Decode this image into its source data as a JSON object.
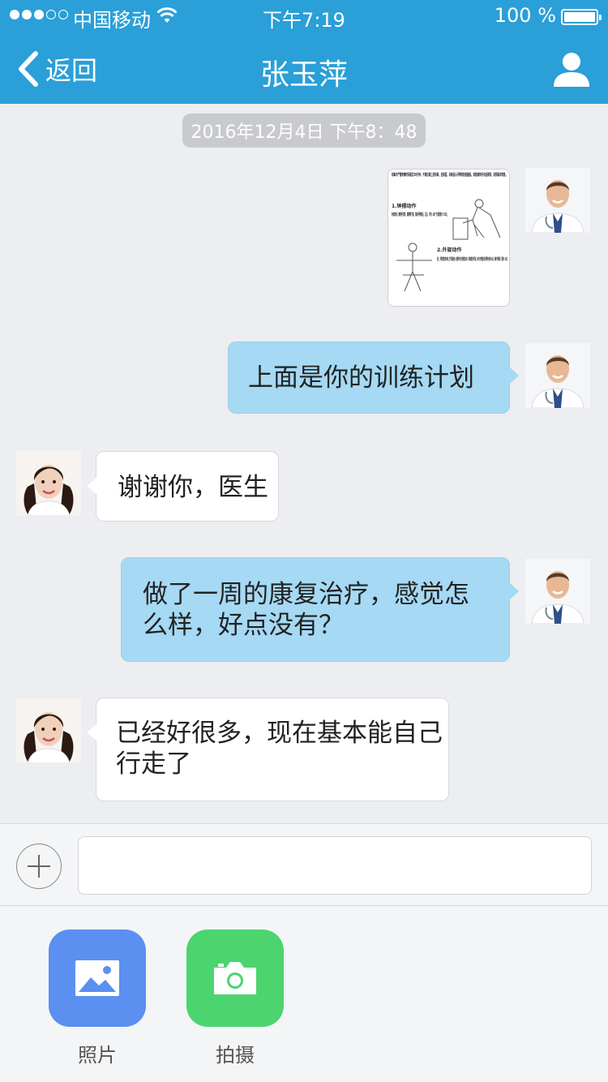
{
  "status_bar": {
    "carrier": "中国移动",
    "time": "下午7:19",
    "battery": "100 %",
    "signal_bars": 3,
    "signal_total": 5
  },
  "nav": {
    "back_label": "返回",
    "title": "张玉萍",
    "profile_icon": "person-icon"
  },
  "timestamp": "2016年12月4日 下午8：48",
  "image_message": {
    "intro": "如每天严重疼痛时间超过30分钟，不建议做上述训练，应就医；训练后从手臂向前拍腿起，如能做到手向后摸背，说明基本恢复。",
    "section1": "1.钟摆动作",
    "section1_text": "身体前倾，健侧手支撑，患侧臂下垂，摇动手臂前后、左右、环形，每个方向重复5~10次。",
    "section2": "2.外旋动作",
    "section2_text": "坐正，手持肘部枕成90度，肘节紧贴身体，健侧手用力向侧推拉木棍，带动患侧关节活动；每个动作都应保证手臂与身体中心线，身体不要倾斜，重复5~10次。"
  },
  "messages": [
    {
      "from": "doctor",
      "lines": [
        "上面是你的训练计划"
      ]
    },
    {
      "from": "patient",
      "lines": [
        "谢谢你，医生"
      ]
    },
    {
      "from": "doctor",
      "lines": [
        "做了一周的康复治疗，感觉怎",
        "么样，好点没有？"
      ]
    },
    {
      "from": "patient",
      "lines": [
        "已经好很多，现在基本能自己",
        "行走了"
      ]
    }
  ],
  "composer": {
    "placeholder": "",
    "value": ""
  },
  "actions": [
    {
      "label": "照片",
      "icon": "image-icon",
      "color": "#5b8ff0"
    },
    {
      "label": "拍摄",
      "icon": "camera-icon",
      "color": "#4cd46f"
    }
  ],
  "colors": {
    "nav_bar": "#2a9fd8",
    "sent_bubble": "#a5d9f4",
    "received_bubble": "#ffffff",
    "background": "#eceef1"
  }
}
